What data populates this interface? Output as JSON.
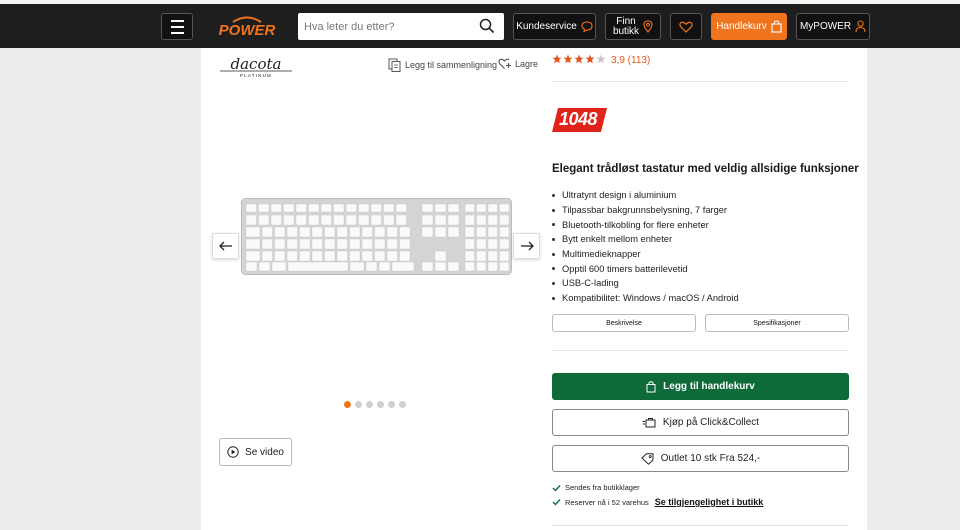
{
  "header": {
    "logo_text": "POWER",
    "search_placeholder": "Hva leter du etter?",
    "customer_service": "Kundeservice",
    "find_store_line1": "Finn",
    "find_store_line2": "butikk",
    "cart": "Handlekurv",
    "account": "MyPOWER",
    "accent_color": "#f0741d"
  },
  "product": {
    "brand": "dacota",
    "brand_sub": "PLATINUM",
    "compare_label": "Legg til sammenligning",
    "save_label": "Lagre",
    "rating_stars": 4,
    "rating_text": "3,9 (113)",
    "price": "1048",
    "title": "Elegant trådløst tastatur med veldig allsidige funksjoner",
    "features": [
      "Ultratynt design i aluminium",
      "Tilpassbar bakgrunnsbelysning, 7 farger",
      "Bluetooth-tilkobling for flere enheter",
      "Bytt enkelt mellom enheter",
      "Multimedieknapper",
      "Opptil 600 timers batterilevetid",
      "USB-C-lading",
      "Kompatibilitet: Windows / macOS / Android"
    ],
    "tab_description": "Beskrivelse",
    "tab_specs": "Spesifikasjoner"
  },
  "gallery": {
    "image_count": 6,
    "active_index": 0,
    "video_label": "Se video"
  },
  "purchase": {
    "add_to_cart": "Legg til handlekurv",
    "click_collect": "Kjøp på Click&Collect",
    "outlet": "Outlet 10 stk Fra 524,-",
    "ships_from_store": "Sendes fra butikklager",
    "in_stock": "Reserver nå i 52 varehus",
    "availability_link": "Se tilgjengelighet i butikk",
    "cart_color": "#0f6a3a"
  }
}
